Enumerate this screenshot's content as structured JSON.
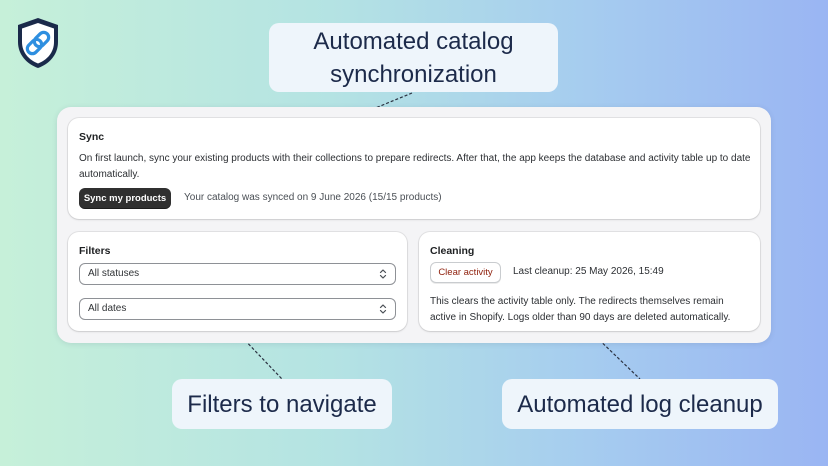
{
  "colors": {
    "primary_button": "#303030",
    "critical_text": "#8e1f0b",
    "callout_bg": "#eef5fb",
    "callout_text": "#1c2a4a"
  },
  "logo": {
    "icon": "shield-link-icon"
  },
  "callouts": {
    "sync": "Automated catalog synchronization",
    "filters": "Filters to navigate",
    "cleanup": "Automated log cleanup"
  },
  "sync": {
    "title": "Sync",
    "description": "On first launch, sync your existing products with their collections to prepare redirects. After that, the app keeps the database and activity table up to date automatically.",
    "button_label": "Sync my products",
    "status": "Your catalog was synced on 9 June 2026 (15/15 products)"
  },
  "filters": {
    "title": "Filters",
    "status_select": {
      "value": "All statuses",
      "icon": "select-chevron-icon"
    },
    "date_select": {
      "value": "All dates",
      "icon": "select-chevron-icon"
    }
  },
  "cleaning": {
    "title": "Cleaning",
    "button_label": "Clear activity",
    "last_cleanup": "Last cleanup: 25 May 2026, 15:49",
    "description": "This clears the activity table only. The redirects themselves remain active in Shopify. Logs older than 90 days are deleted automatically."
  }
}
